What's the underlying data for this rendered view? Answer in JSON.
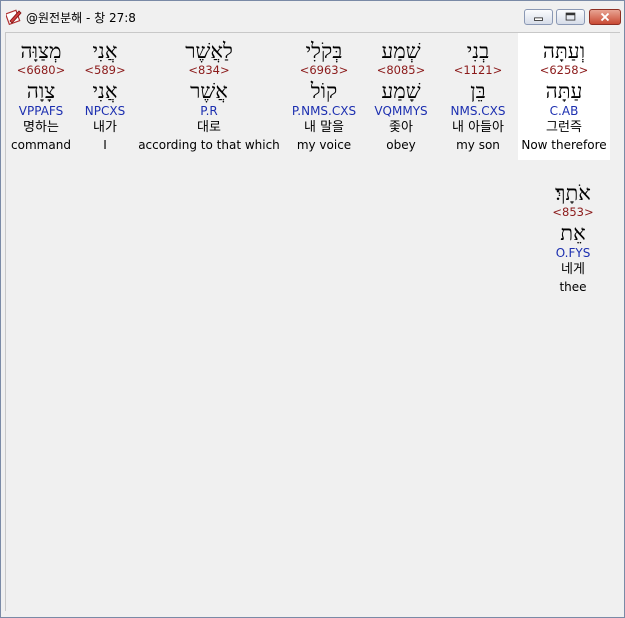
{
  "window": {
    "title": "@원전분해 - 창 27:8",
    "icon": "pencil-bible-icon",
    "controls": [
      "minimize-icon",
      "maximize-icon",
      "close-icon"
    ]
  },
  "words": [
    {
      "heb": "וְעַתָּה",
      "strong": "<6258>",
      "root": "עַתָּה",
      "parse": "C.AB",
      "ko": "그런즉",
      "en": "Now therefore",
      "selected": true
    },
    {
      "heb": "בְנִי",
      "strong": "<1121>",
      "root": "בֵּן",
      "parse": "NMS.CXS",
      "ko": "내 아들아",
      "en": "my son",
      "selected": false
    },
    {
      "heb": "שְׁמַע",
      "strong": "<8085>",
      "root": "שָׁמַע",
      "parse": "VQMMYS",
      "ko": "좇아",
      "en": "obey",
      "selected": false
    },
    {
      "heb": "בְּקֹלִי",
      "strong": "<6963>",
      "root": "קוֹל",
      "parse": "P.NMS.CXS",
      "ko": "내 말을",
      "en": "my voice",
      "selected": false
    },
    {
      "heb": "לַאֲשֶׁר",
      "strong": "<834>",
      "root": "אֲשֶׁר",
      "parse": "P.R",
      "ko": "대로",
      "en": "according to that which",
      "selected": false
    },
    {
      "heb": "אֲנִי",
      "strong": "<589>",
      "root": "אֲנִי",
      "parse": "NPCXS",
      "ko": "내가",
      "en": "I",
      "selected": false
    },
    {
      "heb": "מְצַוָּה",
      "strong": "<6680>",
      "root": "צָוָה",
      "parse": "VPPAFS",
      "ko": "명하는",
      "en": "command",
      "selected": false
    },
    {
      "heb": "אֹתָךְ׃",
      "strong": "<853>",
      "root": "אֵת",
      "parse": "O.FYS",
      "ko": "네게",
      "en": "thee",
      "selected": false
    }
  ]
}
